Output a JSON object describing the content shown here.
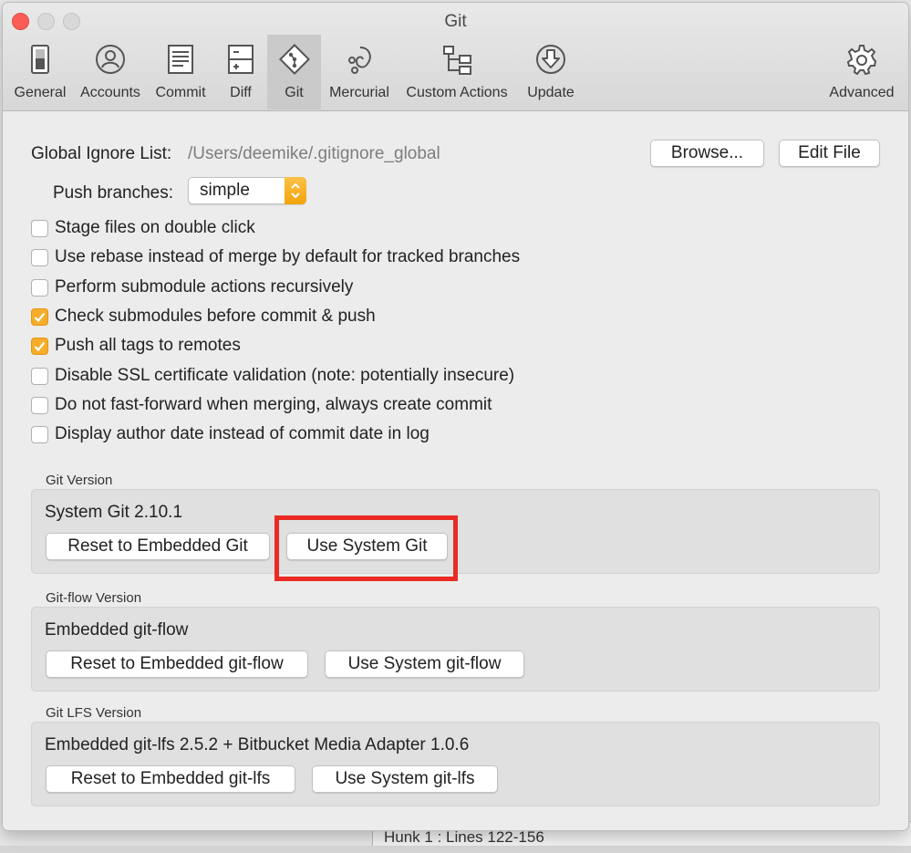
{
  "window": {
    "title": "Git"
  },
  "toolbar": {
    "items": [
      {
        "label": "General",
        "icon": "switch-icon"
      },
      {
        "label": "Accounts",
        "icon": "user-icon"
      },
      {
        "label": "Commit",
        "icon": "document-icon"
      },
      {
        "label": "Diff",
        "icon": "diff-icon"
      },
      {
        "label": "Git",
        "icon": "git-icon",
        "selected": true
      },
      {
        "label": "Mercurial",
        "icon": "mercurial-icon"
      },
      {
        "label": "Custom Actions",
        "icon": "hierarchy-icon"
      },
      {
        "label": "Update",
        "icon": "download-icon"
      },
      {
        "label": "Advanced",
        "icon": "gear-icon"
      }
    ]
  },
  "global_ignore": {
    "label": "Global Ignore List:",
    "path": "/Users/deemike/.gitignore_global",
    "browse_label": "Browse...",
    "edit_label": "Edit File"
  },
  "push_branches": {
    "label": "Push branches:",
    "value": "simple"
  },
  "options": [
    {
      "label": "Stage files on double click",
      "checked": false
    },
    {
      "label": "Use rebase instead of merge by default for tracked branches",
      "checked": false
    },
    {
      "label": "Perform submodule actions recursively",
      "checked": false
    },
    {
      "label": "Check submodules before commit & push",
      "checked": true
    },
    {
      "label": "Push all tags to remotes",
      "checked": true
    },
    {
      "label": "Disable SSL certificate validation (note: potentially insecure)",
      "checked": false
    },
    {
      "label": "Do not fast-forward when merging, always create commit",
      "checked": false
    },
    {
      "label": "Display author date instead of commit date in log",
      "checked": false
    }
  ],
  "git_version": {
    "title": "Git Version",
    "status": "System Git 2.10.1",
    "reset_label": "Reset to Embedded Git",
    "use_label": "Use System Git"
  },
  "gitflow_version": {
    "title": "Git-flow Version",
    "status": "Embedded git-flow",
    "reset_label": "Reset to Embedded git-flow",
    "use_label": "Use System git-flow"
  },
  "gitlfs_version": {
    "title": "Git LFS Version",
    "status": "Embedded git-lfs 2.5.2 + Bitbucket Media Adapter 1.0.6",
    "reset_label": "Reset to Embedded git-lfs",
    "use_label": "Use System git-lfs"
  },
  "background": {
    "hunk_label": "Hunk 1 : Lines 122-156"
  },
  "colors": {
    "accent": "#f6ad2b",
    "highlight": "#ea2a23",
    "close": "#fc5e57"
  }
}
